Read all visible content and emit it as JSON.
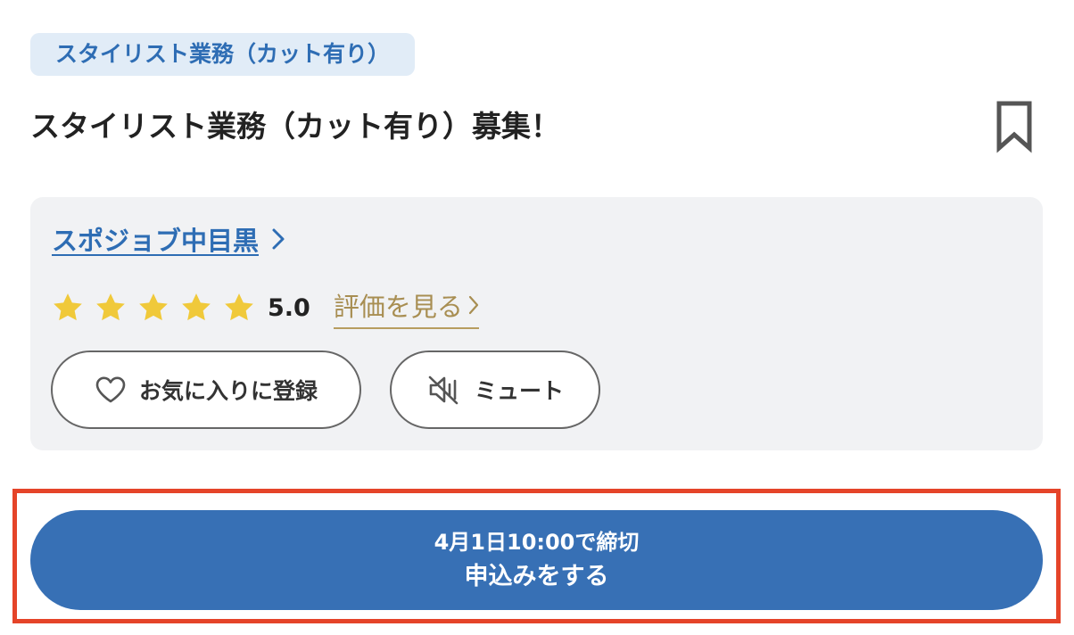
{
  "job": {
    "category_tag": "スタイリスト業務（カット有り）",
    "title": "スタイリスト業務（カット有り）募集！"
  },
  "company": {
    "name": "スポジョブ中目黒",
    "rating": "5.0",
    "star_count": 5,
    "star_value": 5,
    "reviews_link": "評価を見る"
  },
  "actions": {
    "favorite_label": "お気に入りに登録",
    "mute_label": "ミュート"
  },
  "apply": {
    "deadline": "4月1日10:00で締切",
    "label": "申込みをする"
  },
  "icons": {
    "bookmark": "bookmark-icon",
    "company_chevron": "chevron-right-icon",
    "star": "star-icon",
    "reviews_chevron": "chevron-right-icon",
    "favorite": "heart-icon",
    "mute": "speaker-muted-icon"
  },
  "colors": {
    "accent_blue": "#3770b5",
    "tag_background": "#e1ecf7",
    "star_yellow": "#f0c93a",
    "reviews_gold": "#a88e52",
    "highlight_red": "#e54429",
    "card_background": "#f1f2f4"
  }
}
